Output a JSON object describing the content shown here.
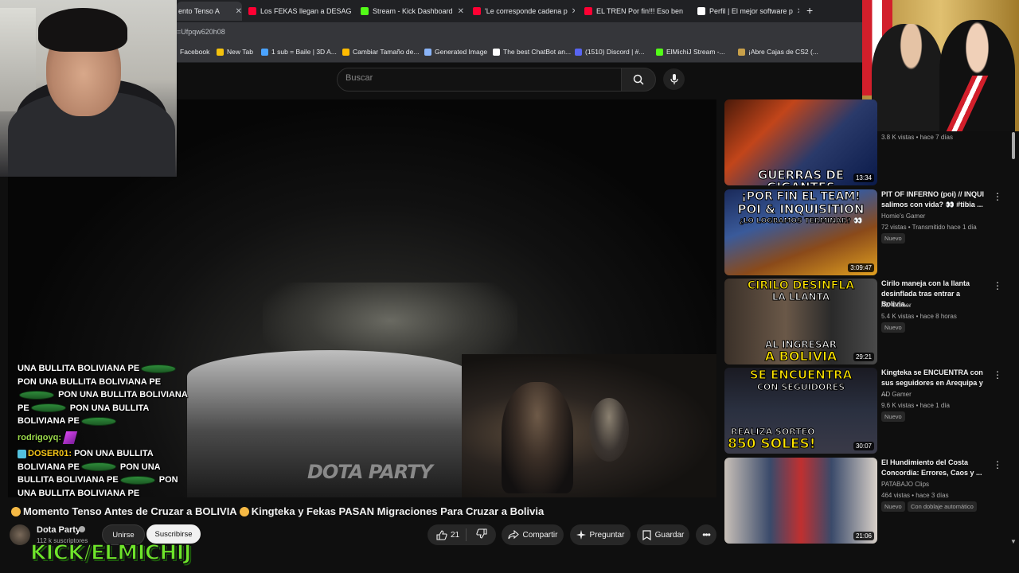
{
  "browser": {
    "tabs": [
      {
        "label": "ento Tenso A",
        "color": "#ff0033"
      },
      {
        "label": "Los FEKAS llegan a DESAG",
        "color": "#ff0033"
      },
      {
        "label": "Stream - Kick Dashboard",
        "color": "#53fc18"
      },
      {
        "label": "'Le corresponde cadena p",
        "color": "#ff0033"
      },
      {
        "label": "EL TREN Por fin!!! Eso ben",
        "color": "#ff0033"
      },
      {
        "label": "Perfil | El mejor software p",
        "color": "#ffffff"
      }
    ],
    "url": "=Ufpqw620h08",
    "bookmarks": [
      "Facebook",
      "New Tab",
      "1 sub = Baile | 3D A...",
      "Cambiar Tamaño de...",
      "Generated Image",
      "The best ChatBot an...",
      "(1510) Discord | #...",
      "ElMichiJ Stream -...",
      "¡Abre Cajas de CS2 (..."
    ]
  },
  "search": {
    "placeholder": "Buscar"
  },
  "video": {
    "watermark": "DOTA PARTY",
    "title": "Momento Tenso Antes de Cruzar a BOLIVIA Kingteka y Fekas PASAN Migraciones Para Cruzar a Bolivia",
    "title_part1": "Momento Tenso Antes de Cruzar a BOLIVIA",
    "title_part2": "Kingteka y Fekas PASAN Migraciones Para Cruzar a Bolivia"
  },
  "chat": {
    "lines": [
      "UNA BULLITA BOLIVIANA PE",
      "PON UNA BULLITA BOLIVIANA PE",
      "PON UNA BULLITA BOLIVIANA",
      "PE",
      "PON UNA BULLITA",
      "BOLIVIANA PE",
      "PON UNA BULLITA",
      "BOLIVIANA PE",
      "PON UNA",
      "BULLITA BOLIVIANA PE",
      "PON",
      "UNA BULLITA BOLIVIANA PE"
    ],
    "user1": "rodrigoyq:",
    "user2": "DOSER01:"
  },
  "channel": {
    "name": "Dota Party",
    "subscribers": "112 k suscriptores",
    "join_label": "Unirse",
    "subscribe_label": "Suscribirse"
  },
  "actions": {
    "likes": "21",
    "share": "Compartir",
    "ask": "Preguntar",
    "save": "Guardar"
  },
  "overlay": {
    "kick": "KICK/ELMICHIJ"
  },
  "related": [
    {
      "thumb_text": "GUERRAS DE GIGANTES",
      "duration": "13:34",
      "meta": "3.8 K vistas • hace 7 días"
    },
    {
      "thumb_text_1": "¡POR FIN EL TEAM!",
      "thumb_text_2": "POI & INQUISITION",
      "thumb_text_3": "¿LO LOGRAMOS TERMINAR? 👀",
      "duration": "3:09:47",
      "title": "PIT OF INFERNO (poi) // INQUI salimos con vida? 👀 #tibia ...",
      "channel": "Homie's Gamer",
      "meta": "72 vistas • Transmitido hace 1 día",
      "badge": "Nuevo"
    },
    {
      "thumb_text_1": "CIRILO DESINFLA",
      "thumb_text_2": "LA LLANTA",
      "thumb_text_3": "AL INGRESAR",
      "thumb_text_4": "A BOLIVIA",
      "duration": "29:21",
      "title": "Cirilo maneja con la llanta desinflada tras entrar a Bolivia...",
      "channel": "AD Gamer",
      "meta": "5.4 K vistas • hace 8 horas",
      "badge": "Nuevo"
    },
    {
      "thumb_text_1": "SE ENCUENTRA",
      "thumb_text_2": "CON SEGUIDORES",
      "thumb_text_3": "REALIZA SORTEO",
      "thumb_text_4": "850 SOLES!",
      "duration": "30:07",
      "title": "Kingteka se ENCUENTRA con sus seguidores en Arequipa y ...",
      "channel": "AD Gamer",
      "meta": "9.6 K vistas • hace 1 día",
      "badge": "Nuevo"
    },
    {
      "duration": "21:06",
      "title": "El Hundimiento del Costa Concordia: Errores, Caos y ...",
      "channel": "PATABAJO Clips",
      "meta": "464 vistas • hace 3 días",
      "badge": "Nuevo",
      "badge2": "Con doblaje automático"
    }
  ],
  "colors": {
    "background": "#0f0f0f",
    "kick_green": "#6ee52a",
    "youtube_red": "#ff0033"
  }
}
